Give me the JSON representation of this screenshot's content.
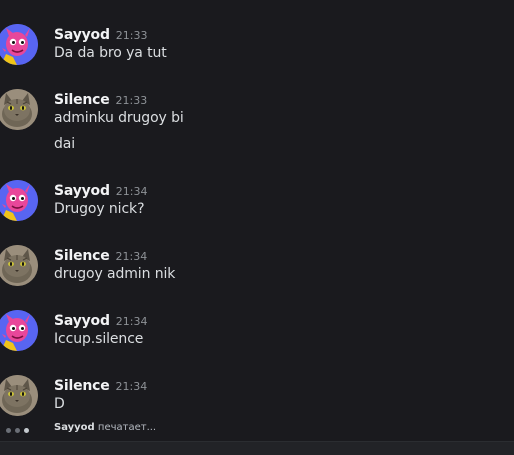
{
  "messages": [
    {
      "user": "Sayyod",
      "time": "21:33",
      "lines": [
        "Da da bro ya tut"
      ],
      "avatar": "pink-creature-avatar"
    },
    {
      "user": "Silence",
      "time": "21:33",
      "lines": [
        "adminku drugoy bi",
        "dai"
      ],
      "avatar": "cat-avatar"
    },
    {
      "user": "Sayyod",
      "time": "21:34",
      "lines": [
        "Drugoy nick?"
      ],
      "avatar": "pink-creature-avatar"
    },
    {
      "user": "Silence",
      "time": "21:34",
      "lines": [
        "drugoy admin nik"
      ],
      "avatar": "cat-avatar"
    },
    {
      "user": "Sayyod",
      "time": "21:34",
      "lines": [
        "Iccup.silence"
      ],
      "avatar": "pink-creature-avatar"
    },
    {
      "user": "Silence",
      "time": "21:34",
      "lines": [
        "D"
      ],
      "avatar": "cat-avatar"
    }
  ],
  "typing": {
    "user": "Sayyod",
    "suffix": "печатает..."
  },
  "colors": {
    "background": "#1a1a1e",
    "sayyod_avatar_bg": "#5865f2",
    "username": "#f2f3f5",
    "timestamp": "#8e9297"
  }
}
